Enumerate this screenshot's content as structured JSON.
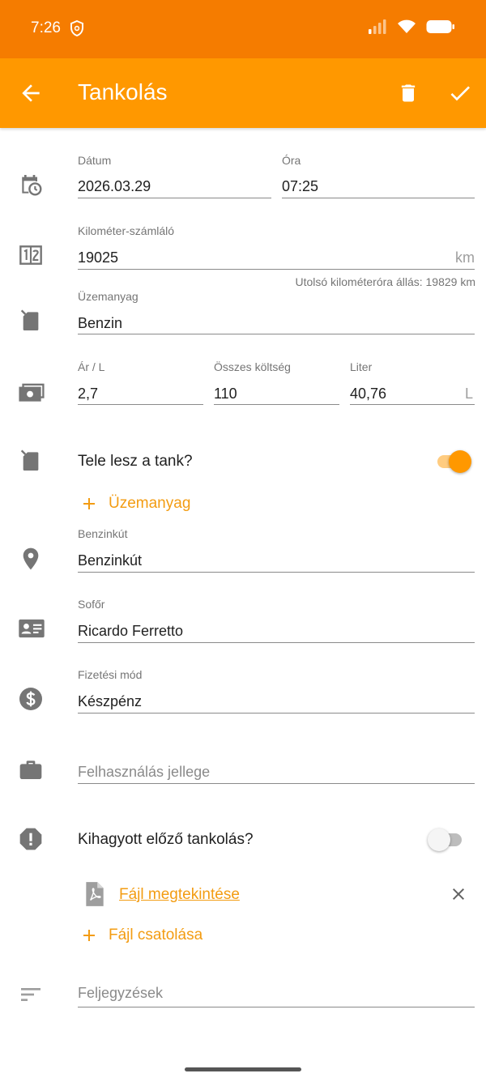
{
  "status_bar": {
    "time": "7:26"
  },
  "app_bar": {
    "title": "Tankolás"
  },
  "form": {
    "date": {
      "label": "Dátum",
      "value": "2026.03.29"
    },
    "time": {
      "label": "Óra",
      "value": "07:25"
    },
    "odometer": {
      "label": "Kilométer-számláló",
      "value": "19025",
      "unit": "km",
      "hint": "Utolsó kilométeróra állás: 19829 km"
    },
    "fuel_type": {
      "label": "Üzemanyag",
      "value": "Benzin"
    },
    "price_per_liter": {
      "label": "Ár / L",
      "value": "2,7"
    },
    "total_cost": {
      "label": "Összes költség",
      "value": "110"
    },
    "liters": {
      "label": "Liter",
      "value": "40,76",
      "unit": "L"
    },
    "full_tank": {
      "label": "Tele lesz a tank?",
      "on": true
    },
    "add_fuel_label": "Üzemanyag",
    "station": {
      "label": "Benzinkút",
      "value": "Benzinkút"
    },
    "driver": {
      "label": "Sofőr",
      "value": "Ricardo Ferretto"
    },
    "payment": {
      "label": "Fizetési mód",
      "value": "Készpénz"
    },
    "usage_type": {
      "placeholder": "Felhasználás jellege"
    },
    "missed_previous": {
      "label": "Kihagyott előző tankolás?",
      "on": false
    },
    "view_file_label": "Fájl megtekintése",
    "attach_file_label": "Fájl csatolása",
    "notes": {
      "placeholder": "Feljegyzések"
    }
  },
  "colors": {
    "accent": "#ff9800",
    "status_bar": "#f57c00",
    "link": "#f39c12",
    "icon": "#757575"
  }
}
